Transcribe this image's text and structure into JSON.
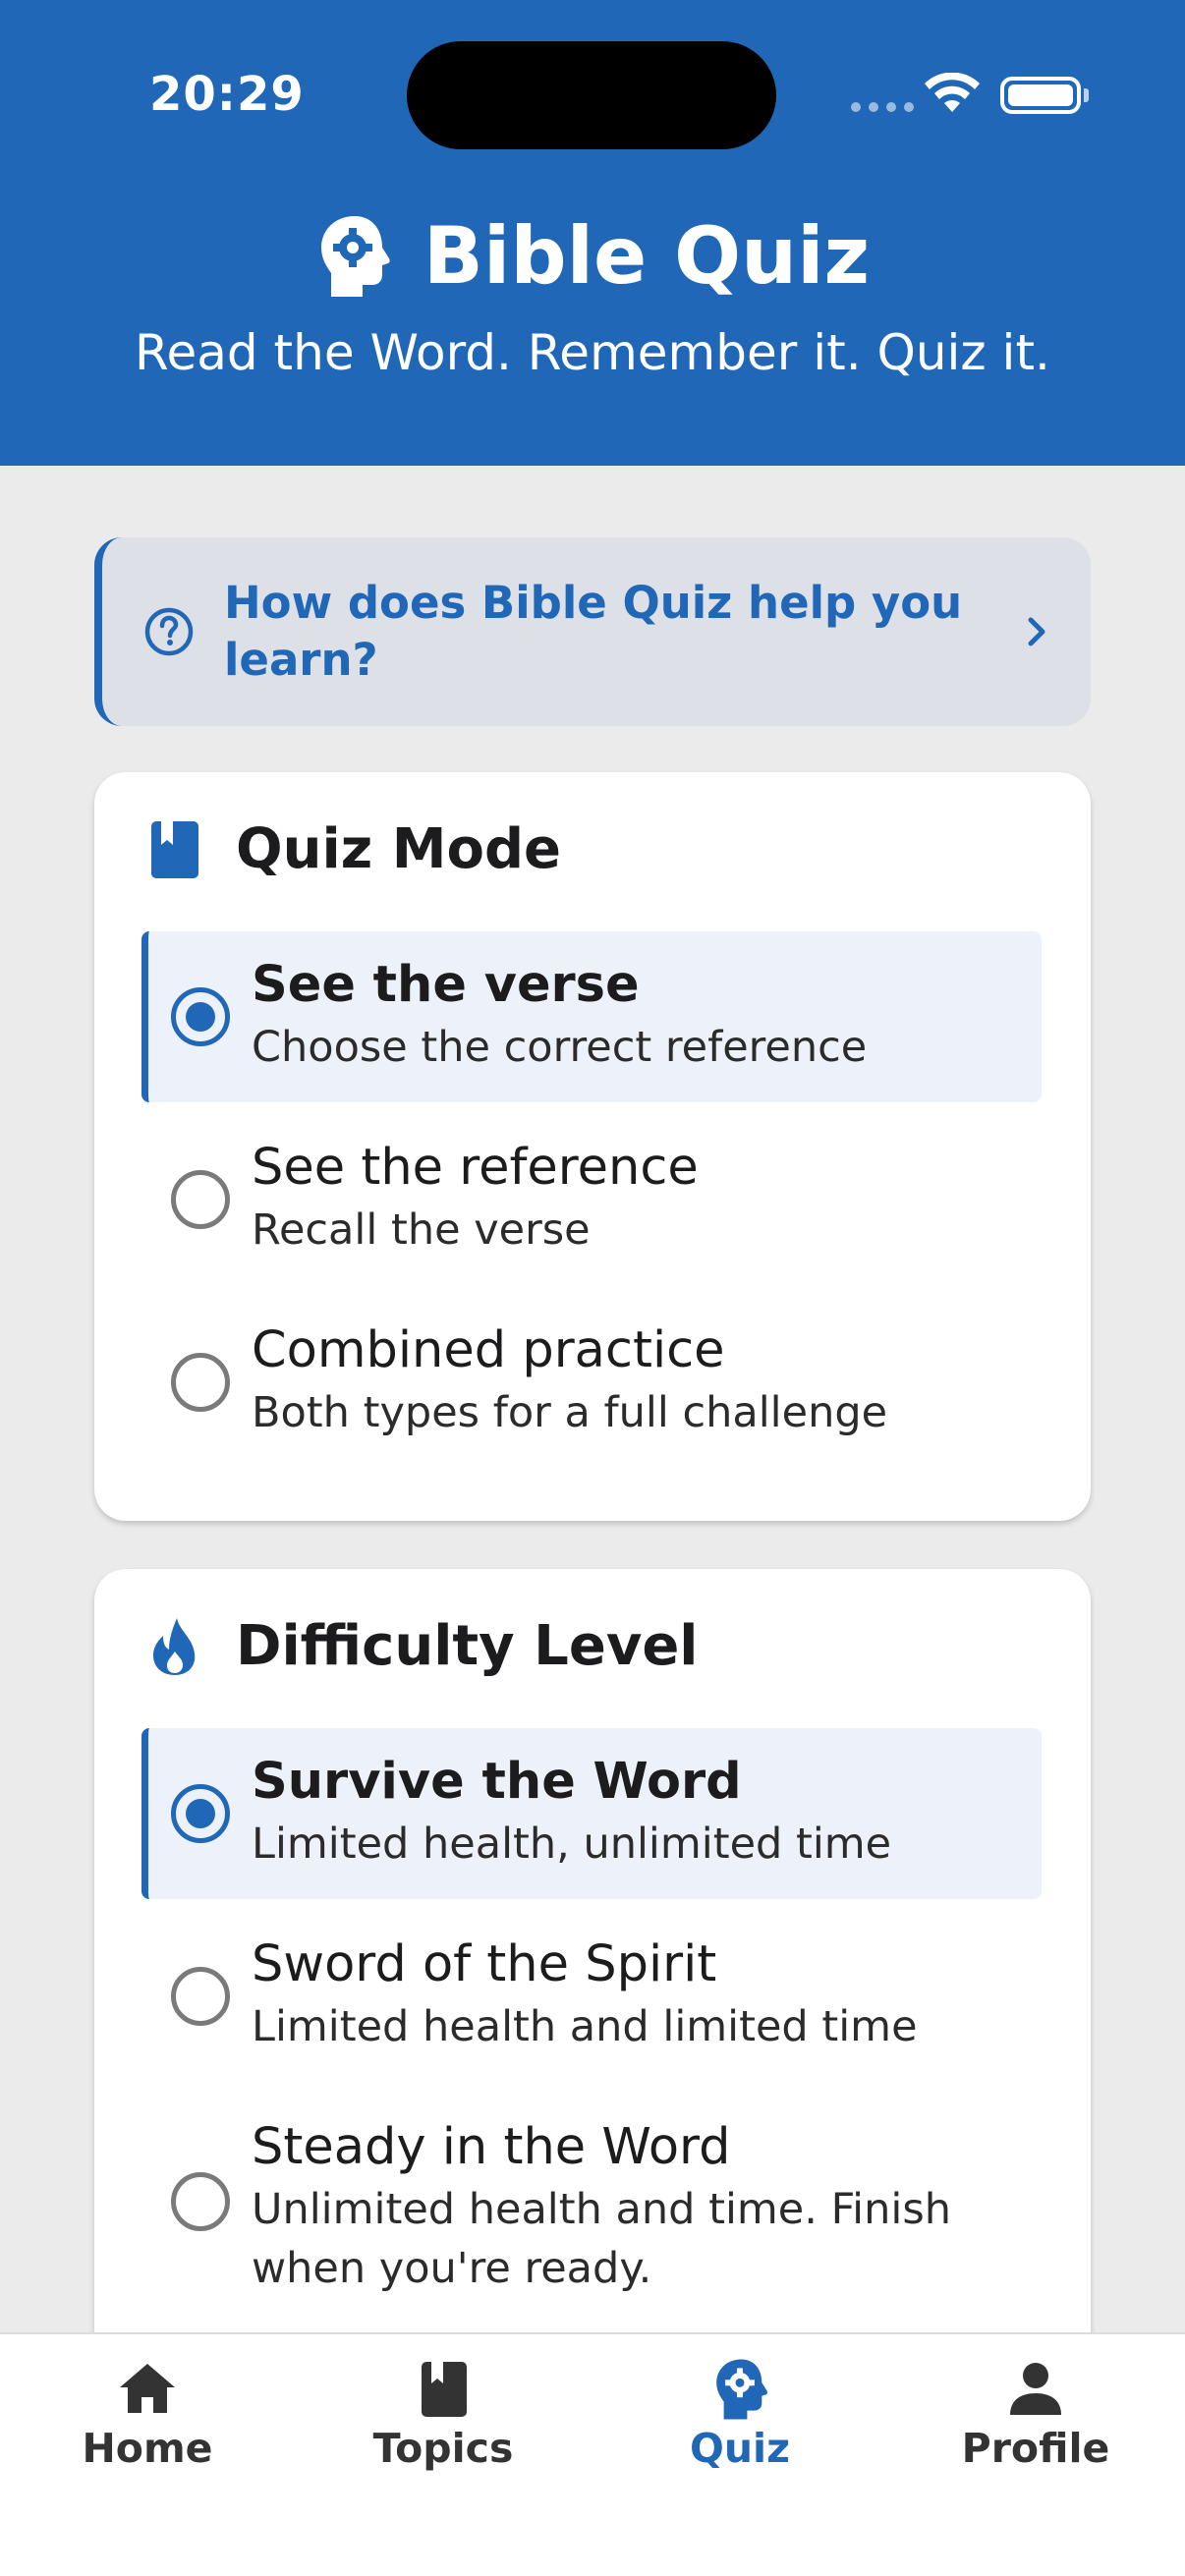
{
  "status_bar": {
    "time": "20:29"
  },
  "header": {
    "title": "Bible Quiz",
    "subtitle": "Read the Word. Remember it. Quiz it.",
    "icon": "head-gear-icon"
  },
  "info_banner": {
    "text": "How does Bible Quiz help you learn?",
    "icon": "help-circle-icon"
  },
  "quiz_mode": {
    "title": "Quiz Mode",
    "icon": "book-icon",
    "options": [
      {
        "title": "See the verse",
        "subtitle": "Choose the correct reference",
        "selected": true
      },
      {
        "title": "See the reference",
        "subtitle": "Recall the verse",
        "selected": false
      },
      {
        "title": "Combined practice",
        "subtitle": "Both types for a full challenge",
        "selected": false
      }
    ]
  },
  "difficulty": {
    "title": "Difficulty Level",
    "icon": "flame-icon",
    "options": [
      {
        "title": "Survive the Word",
        "subtitle": "Limited health, unlimited time",
        "selected": true
      },
      {
        "title": "Sword of the Spirit",
        "subtitle": "Limited health and limited time",
        "selected": false
      },
      {
        "title": "Steady in the Word",
        "subtitle": "Unlimited health and time. Finish when you're ready.",
        "selected": false
      }
    ]
  },
  "tabbar": {
    "tabs": [
      {
        "label": "Home",
        "icon": "home-icon",
        "active": false
      },
      {
        "label": "Topics",
        "icon": "book-icon",
        "active": false
      },
      {
        "label": "Quiz",
        "icon": "head-gear-icon",
        "active": true
      },
      {
        "label": "Profile",
        "icon": "person-icon",
        "active": false
      }
    ]
  },
  "colors": {
    "primary": "#2067b8",
    "background": "#ebebeb",
    "selected_bg": "#edf1fa"
  }
}
